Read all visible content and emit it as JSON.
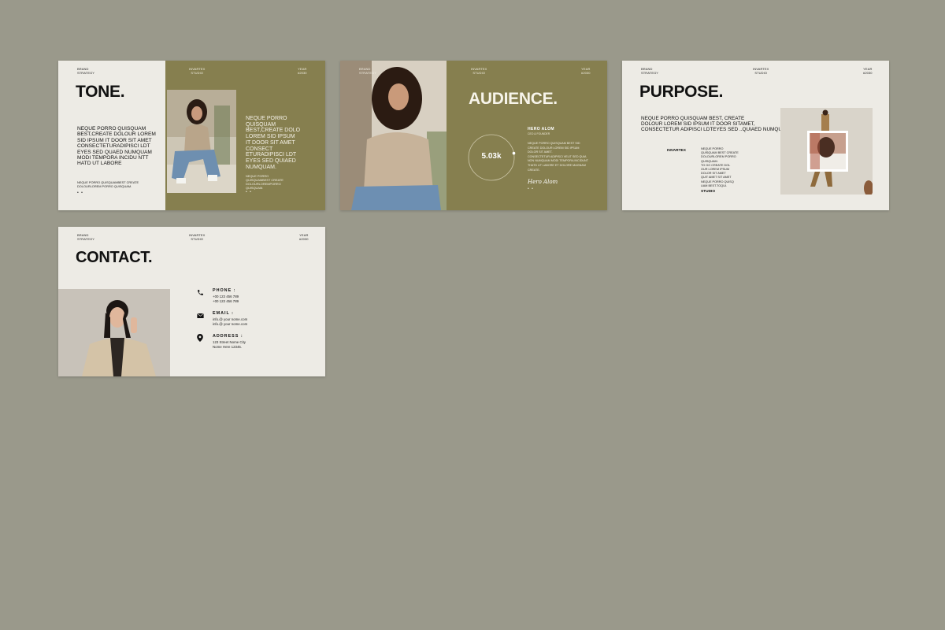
{
  "colors": {
    "background": "#9a998b",
    "slide_light": "#edebe5",
    "slide_olive": "#867f4f",
    "text_dark": "#111111",
    "text_light": "#f1eee2"
  },
  "meta": {
    "left": "BRAND\nSTRATEGY",
    "center": "INVARTEX\nSTUDIO",
    "right": "YEAR\n#2030"
  },
  "tone": {
    "title": "TONE.",
    "body": "NEQUE PORRO QUISQUAM\nBEST,CREATE DOLOUR LOREM\nSID IPSUM IT DOOR SIT AMET\nCONSECTETURADIPISCI LDT\nEYES SED QUAED  NUMQUAM\nMODI TEMPORA INCIDU NTT\nHATD UT LABORE",
    "footnote": "NEQUE PORRO QUISQUAMBEST CREATE\nDOLOURLOREM PORRO QUISQUAM.",
    "right_body": "NEQUE PORRO\nQUISQUAM\nBEST,CREATE DOLO\nLOREM  SID IPSUM\nIT DOOR SIT AMET\nCONSECT\nETURADIPISCI LDT\nEYES SED QUIAED\nNUMQUAM.",
    "right_foot": "NEQUE PORRO\nQUISQUAMBEST CREATE\nDOLOURLOREMPORRO\nQUISQUAM.",
    "dots": "• •",
    "photo_icon": "woman-seated-photo"
  },
  "audience": {
    "title": "AUDIENCE.",
    "stat": "5.03k",
    "progress": 0.22,
    "name": "HERO ALOM",
    "role": "CEO & FOUNDER",
    "body": "NEQUE PORRO QUISQUAM BEST SID\nCREATE DOLOUR LOREM SID IPSUM\nDOLOR SIT AMET.\nCONSECTETUR ADIPISCI VELIT SED QUIA\nNON NUMQUAM MODI TEMPORA INCIDUNT\nTHATD UT LABORE ET DOLORE MAGNAM\nCREATE.",
    "signature": "Hero Alom",
    "dots": "• •",
    "photo_icon": "curly-hair-woman-photo"
  },
  "purpose": {
    "title": "PURPOSE.",
    "body": "NEQUE PORRO QUISQUAM BEST, CREATE\nDOLOUR LOREM SID IPSUM IT DOOR SITAMET,\nCONSECTETUR ADIPISCI LDTEYES SED ..QUIAED NUMQUAM.",
    "brand": "INVARTEX",
    "list": "NEQUE PORRO\nQUISQUAM BEST CREATE\nDOLOURLOREM PORRO\nQUISQUAM.\nTO GO CREATE DOL\nOUR LOREM IPSUM\nDOLOR SIT AMET\nQUIT AMET SIT AMET\nNEQUE PORRO QUISQ\nUAM BEST.TOQUI.",
    "studio": "STUDIO",
    "photo_icon": "walking-figure-photo"
  },
  "contact": {
    "title": "CONTACT.",
    "phone_label": "PHONE :",
    "phone_values": "+00 123 456 789\n+00 123 456 789",
    "email_label": "EMAIL :",
    "email_values": "info.@ your nome.com\ninfo.@ your nome.com",
    "address_label": "ADDRESS :",
    "address_values": "123 Street Nome City\nNome Here 12345.",
    "photo_icon": "smiling-woman-photo"
  }
}
